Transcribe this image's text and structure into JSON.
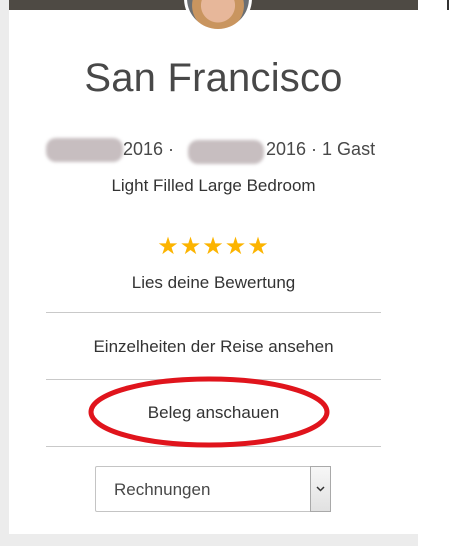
{
  "trip": {
    "city": "San Francisco",
    "check_in_year": "2016 ·",
    "check_out_text": "2016 · 1 Gast",
    "listing_title": "Light Filled Large Bedroom",
    "rating_stars": "★★★★★",
    "rating_value": 5,
    "rating_max": 5
  },
  "actions": {
    "review_label": "Lies deine Bewertung",
    "details_label": "Einzelheiten der Reise ansehen",
    "receipt_label": "Beleg anschauen"
  },
  "invoice_select": {
    "selected": "Rechnungen"
  },
  "colors": {
    "star": "#fcb400",
    "highlight": "#e0141c",
    "text": "#484848",
    "divider": "#c9c9c9"
  }
}
